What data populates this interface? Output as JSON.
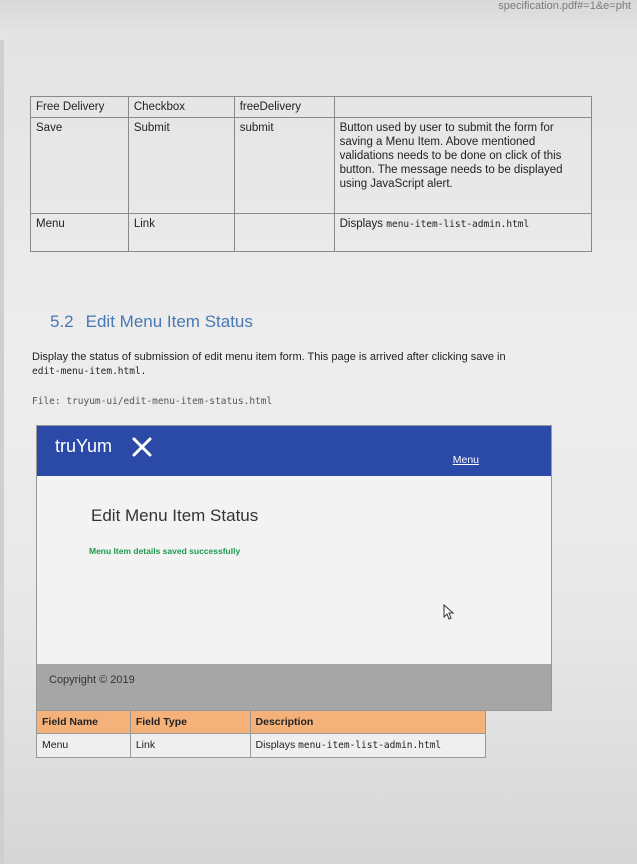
{
  "browser": {
    "url_fragment": "specification.pdf#=1&e=pht"
  },
  "spec_table": {
    "rows": [
      {
        "field": "Free Delivery",
        "type": "Checkbox",
        "name": "freeDelivery",
        "description": ""
      },
      {
        "field": "Save",
        "type": "Submit",
        "name": "submit",
        "description": "Button used by user to submit the form for saving a Menu Item. Above mentioned validations needs to be done on click of this button. The message needs to be displayed using JavaScript alert."
      },
      {
        "field": "Menu",
        "type": "Link",
        "name": "",
        "description_prefix": "Displays ",
        "description_code": "menu-item-list-admin.html"
      }
    ]
  },
  "section": {
    "number": "5.2",
    "title": "Edit Menu Item Status",
    "para_text": "Display the status of submission of edit menu item form. This page is arrived after clicking save in",
    "para_code": "edit-menu-item.html.",
    "file_line": "File: truyum-ui/edit-menu-item-status.html"
  },
  "mockup": {
    "brand": "truYum",
    "nav_link": "Menu",
    "page_title": "Edit Menu Item Status",
    "message": "Menu Item details saved successfully",
    "footer": "Copyright © 2019",
    "colors": {
      "nav": "#2b4aa8",
      "message": "#1c9a4e",
      "footer": "#a6a6a6"
    }
  },
  "fields_table": {
    "headers": [
      "Field Name",
      "Field Type",
      "Description"
    ],
    "rows": [
      {
        "field": "Menu",
        "type": "Link",
        "description_prefix": "Displays ",
        "description_code": "menu-item-list-admin.html"
      }
    ],
    "header_color": "#f4b27a"
  }
}
